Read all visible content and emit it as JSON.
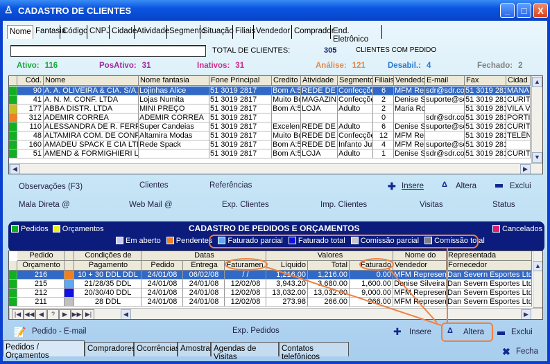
{
  "window": {
    "title": "CADASTRO DE CLIENTES",
    "minimize": "_",
    "maximize": "□",
    "close": "X"
  },
  "search_tabs": [
    "Nome",
    "Fantasia",
    "Código",
    "CNPJ",
    "Cidade",
    "Atividade",
    "Segmento",
    "Situação",
    "Filiais",
    "Vendedor",
    "Comprador",
    "End. Eletrônico"
  ],
  "search": {
    "value": "",
    "total_label": "TOTAL DE CLIENTES:",
    "total": "305",
    "com_pedido_label": "CLIENTES COM PEDIDO"
  },
  "stats": [
    {
      "label": "Ativo:",
      "value": "116",
      "color": "#1aa83a"
    },
    {
      "label": "PosAtivo:",
      "value": "31",
      "color": "#a02aa0"
    },
    {
      "label": "Inativos:",
      "value": "31",
      "color": "#d02a8a"
    },
    {
      "label": "Análise:",
      "value": "121",
      "color": "#e08a50"
    },
    {
      "label": "Desabil.:",
      "value": "4",
      "color": "#2a7ad0"
    },
    {
      "label": "Fechado:",
      "value": "2",
      "color": "#808080"
    }
  ],
  "clients": {
    "columns": [
      "Cód.",
      "Nome",
      "Nome fantasia",
      "Fone Principal",
      "Credito",
      "Atividade",
      "Segmento",
      "Filiais",
      "Vendedor",
      "E-mail",
      "Fax",
      "Cidad"
    ],
    "rows": [
      {
        "status": "#10b020",
        "cells": [
          "90",
          "A. A. OLIVEIRA & CIA. S/A.",
          "Lojinhas Alice",
          "51 3019 2817",
          "Bom A:5",
          "REDE DE",
          "Confecçõe",
          "6",
          "MFM Rep",
          "sdr@sdr.cor",
          "51 3019 281",
          "MANA"
        ]
      },
      {
        "status": "#10b020",
        "cells": [
          "41",
          "A. N. M. CONF. LTDA",
          "Lojas Numita",
          "51 3019 2817",
          "Muito Bo",
          "MAGAZINI",
          "Confecçõe",
          "2",
          "Denise S",
          "suporte@sc",
          "51 3019 281",
          "CURIT"
        ]
      },
      {
        "status": "#c8c020",
        "cells": [
          "177",
          "ABBA DISTR. LTDA",
          "MINI PREÇO",
          "51 3019 2817",
          "Bom A:5",
          "LOJA",
          "Adulto",
          "2",
          "Maria Ro",
          "",
          "51 3019 281",
          "VILA V"
        ]
      },
      {
        "status": "#f08020",
        "cells": [
          "312",
          "ADEMIR CORREA",
          "ADEMIR CORREA",
          "51 3019 2817",
          "",
          "",
          "",
          "0",
          "",
          "sdr@sdr.cor",
          "51 3019 281",
          "PORTI"
        ]
      },
      {
        "status": "#10b020",
        "cells": [
          "110",
          "ALESSANDRA DE R. FERR",
          "Super Candeias",
          "51 3019 2817",
          "Excelent",
          "REDE DE",
          "Adulto",
          "6",
          "Denise S",
          "suporte@sc",
          "51 3019 281",
          "CURIT"
        ]
      },
      {
        "status": "#10b020",
        "cells": [
          "48",
          "ALTAMIRA COM. DE CONF",
          "Altamira Modas",
          "51 3019 2817",
          "Muito Bo",
          "REDE DE",
          "Confecçõe",
          "12",
          "MFM Rep",
          "",
          "51 3019 281",
          "TELÊN"
        ]
      },
      {
        "status": "#10b020",
        "cells": [
          "160",
          "AMADEU SPACK E CIA LTD",
          "Rede Spack",
          "51 3019 2817",
          "Bom A:5",
          "REDE DE",
          "Infanto Juv",
          "4",
          "MFM Rep",
          "suporte@sc",
          "51 3019 281",
          ""
        ]
      },
      {
        "status": "#10b020",
        "cells": [
          "51",
          "AMEND & FORMIGHIERI LT",
          "",
          "51 3019 2817",
          "Bom A:5",
          "LOJA",
          "Adulto",
          "1",
          "Denise S",
          "sdr@sdr.cor",
          "51 3019 281",
          "CURIT"
        ]
      }
    ]
  },
  "actions_top": {
    "observacoes": "Observações (F3)",
    "clientes": "Clientes",
    "referencias": "Referências",
    "insere": "Insere",
    "altera": "Altera",
    "exclui": "Exclui",
    "mala": "Mala Direta @",
    "webmail": "Web Mail @",
    "exp": "Exp. Clientes",
    "imp": "Imp. Clientes",
    "visitas": "Visitas",
    "status": "Status"
  },
  "orders_panel": {
    "title": "CADASTRO DE PEDIDOS E ORÇAMENTOS",
    "legend_left": [
      {
        "label": "Pedidos",
        "color": "#10b020"
      },
      {
        "label": "Orçamentos",
        "color": "#f0f020"
      }
    ],
    "legend_right": {
      "label": "Cancelados",
      "color": "#e0206a"
    },
    "legend_status": [
      {
        "label": "Em aberto",
        "color": "#c8c8f0"
      },
      {
        "label": "Pendentes",
        "color": "#f08020"
      },
      {
        "label": "Faturado parcial",
        "color": "#60a8f0"
      },
      {
        "label": "Faturado total",
        "color": "#1010e0"
      },
      {
        "label": "Comissão parcial",
        "color": "#c8c8c8"
      },
      {
        "label": "Comissão total",
        "color": "#808080"
      }
    ]
  },
  "orders": {
    "group_headers": {
      "pedido": "Pedido",
      "condicoes": "Condições de",
      "datas": "Datas",
      "valores": "Valores",
      "nome_do": "Nome do",
      "representada": "Representada"
    },
    "columns": [
      "Orçamento",
      "Pagamento",
      "Pedido",
      "Entrega",
      "Faturamen.",
      "Líquido",
      "Total",
      "Faturado",
      "Vendedor",
      "Fornecedor"
    ],
    "rows": [
      {
        "type": "#10b020",
        "status": "#f08020",
        "cells": [
          "216",
          "10 + 30 DDL DDL",
          "24/01/08",
          "06/02/08",
          "  /  /",
          "1,216.00",
          "1,216.00",
          "0.00",
          "MFM Represen",
          "Dan Severn Esportes Ltd"
        ]
      },
      {
        "type": "#10b020",
        "status": "#60a8f0",
        "cells": [
          "215",
          "21/28/35 DDL",
          "24/01/08",
          "24/01/08",
          "12/02/08",
          "3,943.20",
          "3,680.00",
          "1,600.00",
          "Denise Silveira",
          "Dan Severn Esportes Ltd"
        ]
      },
      {
        "type": "#10b020",
        "status": "#1010e0",
        "cells": [
          "212",
          "20/30/40 DDL",
          "24/01/08",
          "24/01/08",
          "12/02/08",
          "13,032.00",
          "13,032.00",
          "9,000.00",
          "MFM Represen",
          "Dan Severn Esportes Ltd"
        ]
      },
      {
        "type": "#10b020",
        "status": "#c0c0c0",
        "cells": [
          "211",
          "28 DDL",
          "24/01/08",
          "24/01/08",
          "12/02/08",
          "273.98",
          "266.00",
          "266.00",
          "MFM Represen",
          "Dan Severn Esportes Ltd"
        ]
      }
    ]
  },
  "navigator": [
    "|◀",
    "◀◀",
    "◀",
    "?",
    "▶",
    "▶▶",
    "▶|"
  ],
  "actions_bottom": {
    "pedido_email": "Pedido - E-mail",
    "exp": "Exp. Pedidos",
    "insere": "Insere",
    "altera": "Altera",
    "exclui": "Exclui",
    "fecha": "Fecha"
  },
  "bottom_tabs": [
    "Pedidos / Orçamentos",
    "Compradores",
    "Ocorrências",
    "Amostras",
    "Agendas de Visitas",
    "Contatos telefônicos"
  ],
  "annotation_color": "#f08040"
}
